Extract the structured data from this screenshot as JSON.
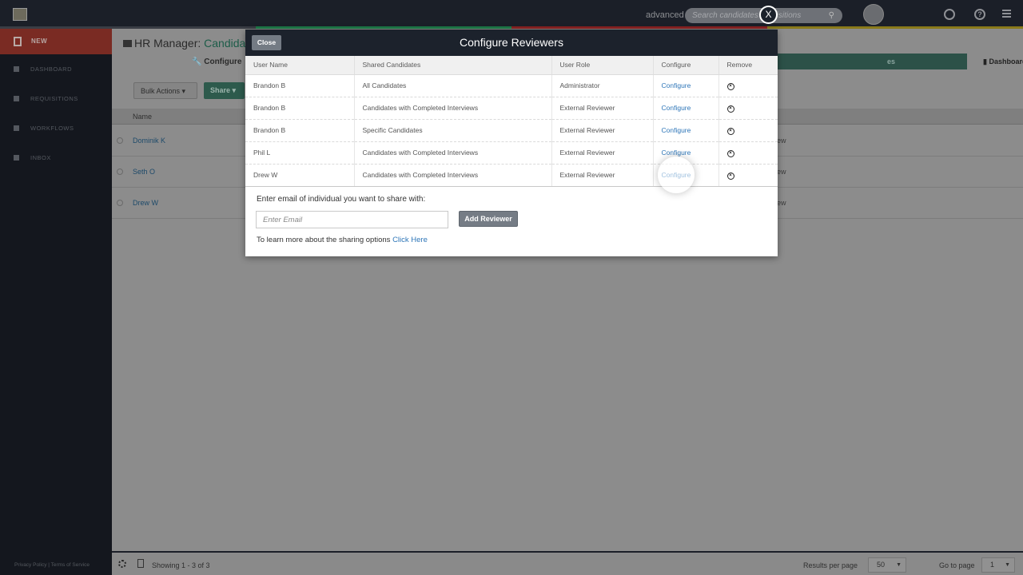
{
  "topbar": {
    "advanced": "advanced",
    "search_placeholder": "Search candidates requisitions",
    "icons": [
      "globe-icon",
      "help-icon",
      "menu-icon"
    ]
  },
  "sidebar": {
    "new": "NEW",
    "items": [
      {
        "label": "DASHBOARD",
        "icon": "bar-chart-icon"
      },
      {
        "label": "REQUISITIONS",
        "icon": "document-icon"
      },
      {
        "label": "WORKFLOWS",
        "icon": "workflow-icon"
      },
      {
        "label": "INBOX",
        "icon": "envelope-icon"
      }
    ],
    "legal": "Privacy Policy | Terms of Service"
  },
  "content": {
    "title_prefix": "HR Manager:",
    "title_accent": "Candidat",
    "configure_tab": "Configure",
    "step_done": "es",
    "step_dashboard": "Dashboard",
    "bulk_actions": "Bulk Actions",
    "share": "Share",
    "name_header": "Name",
    "rows": [
      {
        "name": "Dominik K",
        "right": "ew"
      },
      {
        "name": "Seth O",
        "right": "ew"
      },
      {
        "name": "Drew W",
        "right": "ew"
      }
    ]
  },
  "footer": {
    "showing": "Showing 1 - 3 of 3",
    "results_per_page": "Results per page",
    "rpp_value": "50",
    "go_to_page": "Go to page",
    "page_value": "1"
  },
  "modal": {
    "close_label": "Close",
    "title": "Configure Reviewers",
    "columns": [
      "User Name",
      "Shared Candidates",
      "User Role",
      "Configure",
      "Remove"
    ],
    "rows": [
      {
        "user": "Brandon B",
        "shared": "All Candidates",
        "role": "Administrator",
        "configure": "Configure"
      },
      {
        "user": "Brandon B",
        "shared": "Candidates with Completed Interviews",
        "role": "External Reviewer",
        "configure": "Configure"
      },
      {
        "user": "Brandon B",
        "shared": "Specific Candidates",
        "role": "External Reviewer",
        "configure": "Configure"
      },
      {
        "user": "Phil L",
        "shared": "Candidates with Completed Interviews",
        "role": "External Reviewer",
        "configure": "Configure"
      },
      {
        "user": "Drew W",
        "shared": "Candidates with Completed Interviews",
        "role": "External Reviewer",
        "configure": "Configure"
      }
    ],
    "share_label": "Enter email of individual you want to share with:",
    "email_placeholder": "Enter Email",
    "add_reviewer": "Add Reviewer",
    "learn_text": "To learn more about the sharing options",
    "learn_link": "Click Here"
  },
  "float_close": "X"
}
